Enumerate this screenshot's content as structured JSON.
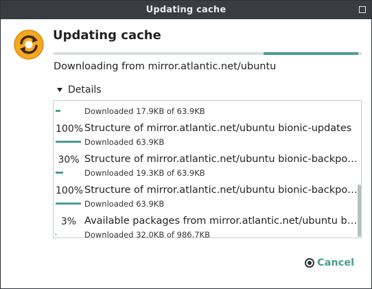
{
  "window": {
    "title": "Updating cache"
  },
  "header": {
    "heading": "Updating cache",
    "progress_fraction": 0.31,
    "status": "Downloading from mirror.atlantic.net/ubuntu"
  },
  "details": {
    "label": "Details",
    "expanded": true
  },
  "items": [
    {
      "percent": "20%",
      "progress": 0.2,
      "title": "",
      "subtitle": "Downloaded 17.9KB of 63.9KB"
    },
    {
      "percent": "100%",
      "progress": 1.0,
      "title": "Structure of mirror.atlantic.net/ubuntu bionic-updates",
      "subtitle": "Downloaded 63.9KB"
    },
    {
      "percent": "30%",
      "progress": 0.3,
      "title": "Structure of mirror.atlantic.net/ubuntu bionic-backports",
      "subtitle": "Downloaded 19.3KB of 63.9KB"
    },
    {
      "percent": "100%",
      "progress": 1.0,
      "title": "Structure of mirror.atlantic.net/ubuntu bionic-backports",
      "subtitle": "Downloaded 63.9KB"
    },
    {
      "percent": "3%",
      "progress": 0.03,
      "title": "Available packages from mirror.atlantic.net/ubuntu bionic-updates",
      "subtitle": "Downloaded 32.0KB of 986.7KB"
    }
  ],
  "footer": {
    "cancel_label": "Cancel"
  },
  "colors": {
    "accent": "#4a9d93",
    "titlebar": "#373e41",
    "icon": "#f5a623"
  }
}
